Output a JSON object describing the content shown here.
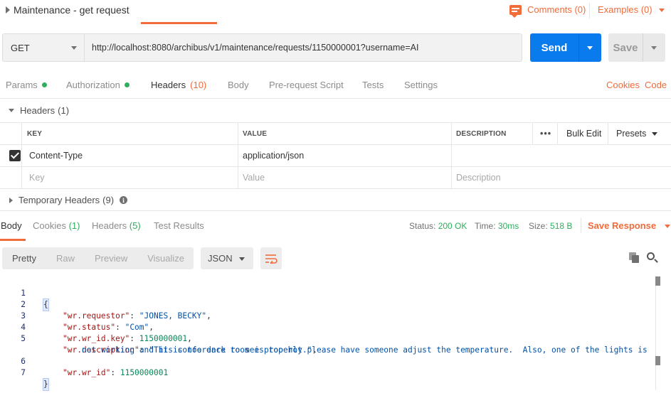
{
  "request": {
    "name": "Maintenance - get request",
    "comments_label": "Comments (0)",
    "examples_label": "Examples (0)",
    "method": "GET",
    "url": "http://localhost:8080/archibus/v1/maintenance/requests/1150000001?username=AI",
    "send_label": "Send",
    "save_label": "Save"
  },
  "request_tabs": {
    "params": "Params",
    "authorization": "Authorization",
    "headers": "Headers",
    "headers_count": "(10)",
    "body": "Body",
    "pre_request": "Pre-request Script",
    "tests": "Tests",
    "settings": "Settings",
    "cookies": "Cookies",
    "code": "Code"
  },
  "headers_section": {
    "title": "Headers",
    "count": "(1)",
    "columns": {
      "key": "KEY",
      "value": "VALUE",
      "description": "DESCRIPTION"
    },
    "more": "•••",
    "bulk_edit": "Bulk Edit",
    "presets": "Presets",
    "rows": [
      {
        "key": "Content-Type",
        "value": "application/json",
        "description": "",
        "checked": true
      }
    ],
    "placeholders": {
      "key": "Key",
      "value": "Value",
      "description": "Description"
    },
    "temporary_title": "Temporary Headers",
    "temporary_count": "(9)"
  },
  "response_tabs": {
    "body": "Body",
    "cookies": "Cookies",
    "cookies_count": "(1)",
    "headers": "Headers",
    "headers_count": "(5)",
    "test_results": "Test Results"
  },
  "response_stats": {
    "status_label": "Status:",
    "status_value": "200 OK",
    "time_label": "Time:",
    "time_value": "30ms",
    "size_label": "Size:",
    "size_value": "518 B",
    "save_response": "Save Response"
  },
  "view_modes": {
    "pretty": "Pretty",
    "raw": "Raw",
    "preview": "Preview",
    "visualize": "Visualize",
    "format": "JSON"
  },
  "body_lines": {
    "n1": "1",
    "n2": "2",
    "n3": "3",
    "n4": "4",
    "n5": "5",
    "n6": "6",
    "n7": "7",
    "open": "{",
    "close": "}",
    "k_requestor": "\"wr.requestor\"",
    "v_requestor": "\"JONES, BECKY\"",
    "k_status": "\"wr.status\"",
    "v_status": "\"Com\"",
    "k_wrid_key": "\"wr.wr_id.key\"",
    "v_wrid_key": "1150000001",
    "k_description": "\"wr.description\"",
    "v_description_1": "\"This conference room is too hot please have someone adjust the temperature.  Also, one of the lights is",
    "v_description_2": "not working and it is too dark to see properly.\"",
    "k_wrid": "\"wr.wr_id\"",
    "v_wrid": "1150000001"
  },
  "icons": {
    "comment": "comment-icon",
    "copy": "copy-icon",
    "search": "search-icon",
    "wrap": "wrap-lines-icon",
    "info": "info-icon",
    "check": "checkbox-checked-icon"
  },
  "colors": {
    "accent": "#f26b3a",
    "send": "#097bed",
    "success": "#2fae5f"
  }
}
